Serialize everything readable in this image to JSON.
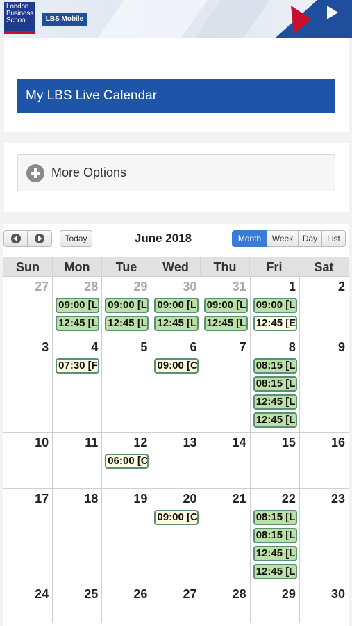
{
  "header": {
    "logo_lines": [
      "London",
      "Business",
      "School"
    ],
    "mobile_label": "LBS Mobile"
  },
  "page": {
    "title": "My LBS Live Calendar",
    "more_options_label": "More Options"
  },
  "toolbar": {
    "today_label": "Today",
    "month_title": "June 2018",
    "views": [
      "Month",
      "Week",
      "Day",
      "List"
    ],
    "active_view": "Month"
  },
  "calendar": {
    "weekdays": [
      "Sun",
      "Mon",
      "Tue",
      "Wed",
      "Thu",
      "Fri",
      "Sat"
    ],
    "weeks": [
      [
        {
          "day": "27",
          "other": true,
          "events": []
        },
        {
          "day": "28",
          "other": true,
          "events": [
            {
              "text": "09:00 [L",
              "color": "green"
            },
            {
              "text": "12:45 [L",
              "color": "green"
            }
          ]
        },
        {
          "day": "29",
          "other": true,
          "events": [
            {
              "text": "09:00 [L",
              "color": "green"
            },
            {
              "text": "12:45 [L",
              "color": "green"
            }
          ]
        },
        {
          "day": "30",
          "other": true,
          "events": [
            {
              "text": "09:00 [L",
              "color": "green"
            },
            {
              "text": "12:45 [L",
              "color": "green"
            }
          ]
        },
        {
          "day": "31",
          "other": true,
          "events": [
            {
              "text": "09:00 [L",
              "color": "green"
            },
            {
              "text": "12:45 [L",
              "color": "green"
            }
          ]
        },
        {
          "day": "1",
          "other": false,
          "events": [
            {
              "text": "09:00 [L",
              "color": "green"
            },
            {
              "text": "12:45 [E",
              "color": "yellow"
            }
          ]
        },
        {
          "day": "2",
          "other": false,
          "events": []
        }
      ],
      [
        {
          "day": "3",
          "other": false,
          "events": []
        },
        {
          "day": "4",
          "other": false,
          "events": [
            {
              "text": "07:30 [F",
              "color": "yellow"
            }
          ]
        },
        {
          "day": "5",
          "other": false,
          "events": []
        },
        {
          "day": "6",
          "other": false,
          "events": [
            {
              "text": "09:00 [C",
              "color": "yellow"
            }
          ]
        },
        {
          "day": "7",
          "other": false,
          "events": []
        },
        {
          "day": "8",
          "other": false,
          "events": [
            {
              "text": "08:15 [L",
              "color": "green"
            },
            {
              "text": "08:15 [L",
              "color": "green"
            },
            {
              "text": "12:45 [L",
              "color": "green"
            },
            {
              "text": "12:45 [L",
              "color": "green"
            }
          ]
        },
        {
          "day": "9",
          "other": false,
          "events": []
        }
      ],
      [
        {
          "day": "10",
          "other": false,
          "events": []
        },
        {
          "day": "11",
          "other": false,
          "events": []
        },
        {
          "day": "12",
          "other": false,
          "events": [
            {
              "text": "06:00 [C",
              "color": "yellow"
            }
          ]
        },
        {
          "day": "13",
          "other": false,
          "events": []
        },
        {
          "day": "14",
          "other": false,
          "events": []
        },
        {
          "day": "15",
          "other": false,
          "events": []
        },
        {
          "day": "16",
          "other": false,
          "events": []
        }
      ],
      [
        {
          "day": "17",
          "other": false,
          "events": []
        },
        {
          "day": "18",
          "other": false,
          "events": []
        },
        {
          "day": "19",
          "other": false,
          "events": []
        },
        {
          "day": "20",
          "other": false,
          "events": [
            {
              "text": "09:00 [C",
              "color": "yellow"
            }
          ]
        },
        {
          "day": "21",
          "other": false,
          "events": []
        },
        {
          "day": "22",
          "other": false,
          "events": [
            {
              "text": "08:15 [L",
              "color": "green"
            },
            {
              "text": "08:15 [L",
              "color": "green"
            },
            {
              "text": "12:45 [L",
              "color": "green"
            },
            {
              "text": "12:45 [L",
              "color": "green"
            }
          ]
        },
        {
          "day": "23",
          "other": false,
          "events": []
        }
      ],
      [
        {
          "day": "24",
          "other": false,
          "events": []
        },
        {
          "day": "25",
          "other": false,
          "events": []
        },
        {
          "day": "26",
          "other": false,
          "events": []
        },
        {
          "day": "27",
          "other": false,
          "events": []
        },
        {
          "day": "28",
          "other": false,
          "events": []
        },
        {
          "day": "29",
          "other": false,
          "events": []
        },
        {
          "day": "30",
          "other": false,
          "events": []
        }
      ]
    ]
  },
  "colors": {
    "brand_blue": "#1f55a8",
    "active_view": "#3a7bd5",
    "event_green": "#bde0a6",
    "event_yellow": "#fffbe0",
    "lbs_red": "#c8102e"
  }
}
